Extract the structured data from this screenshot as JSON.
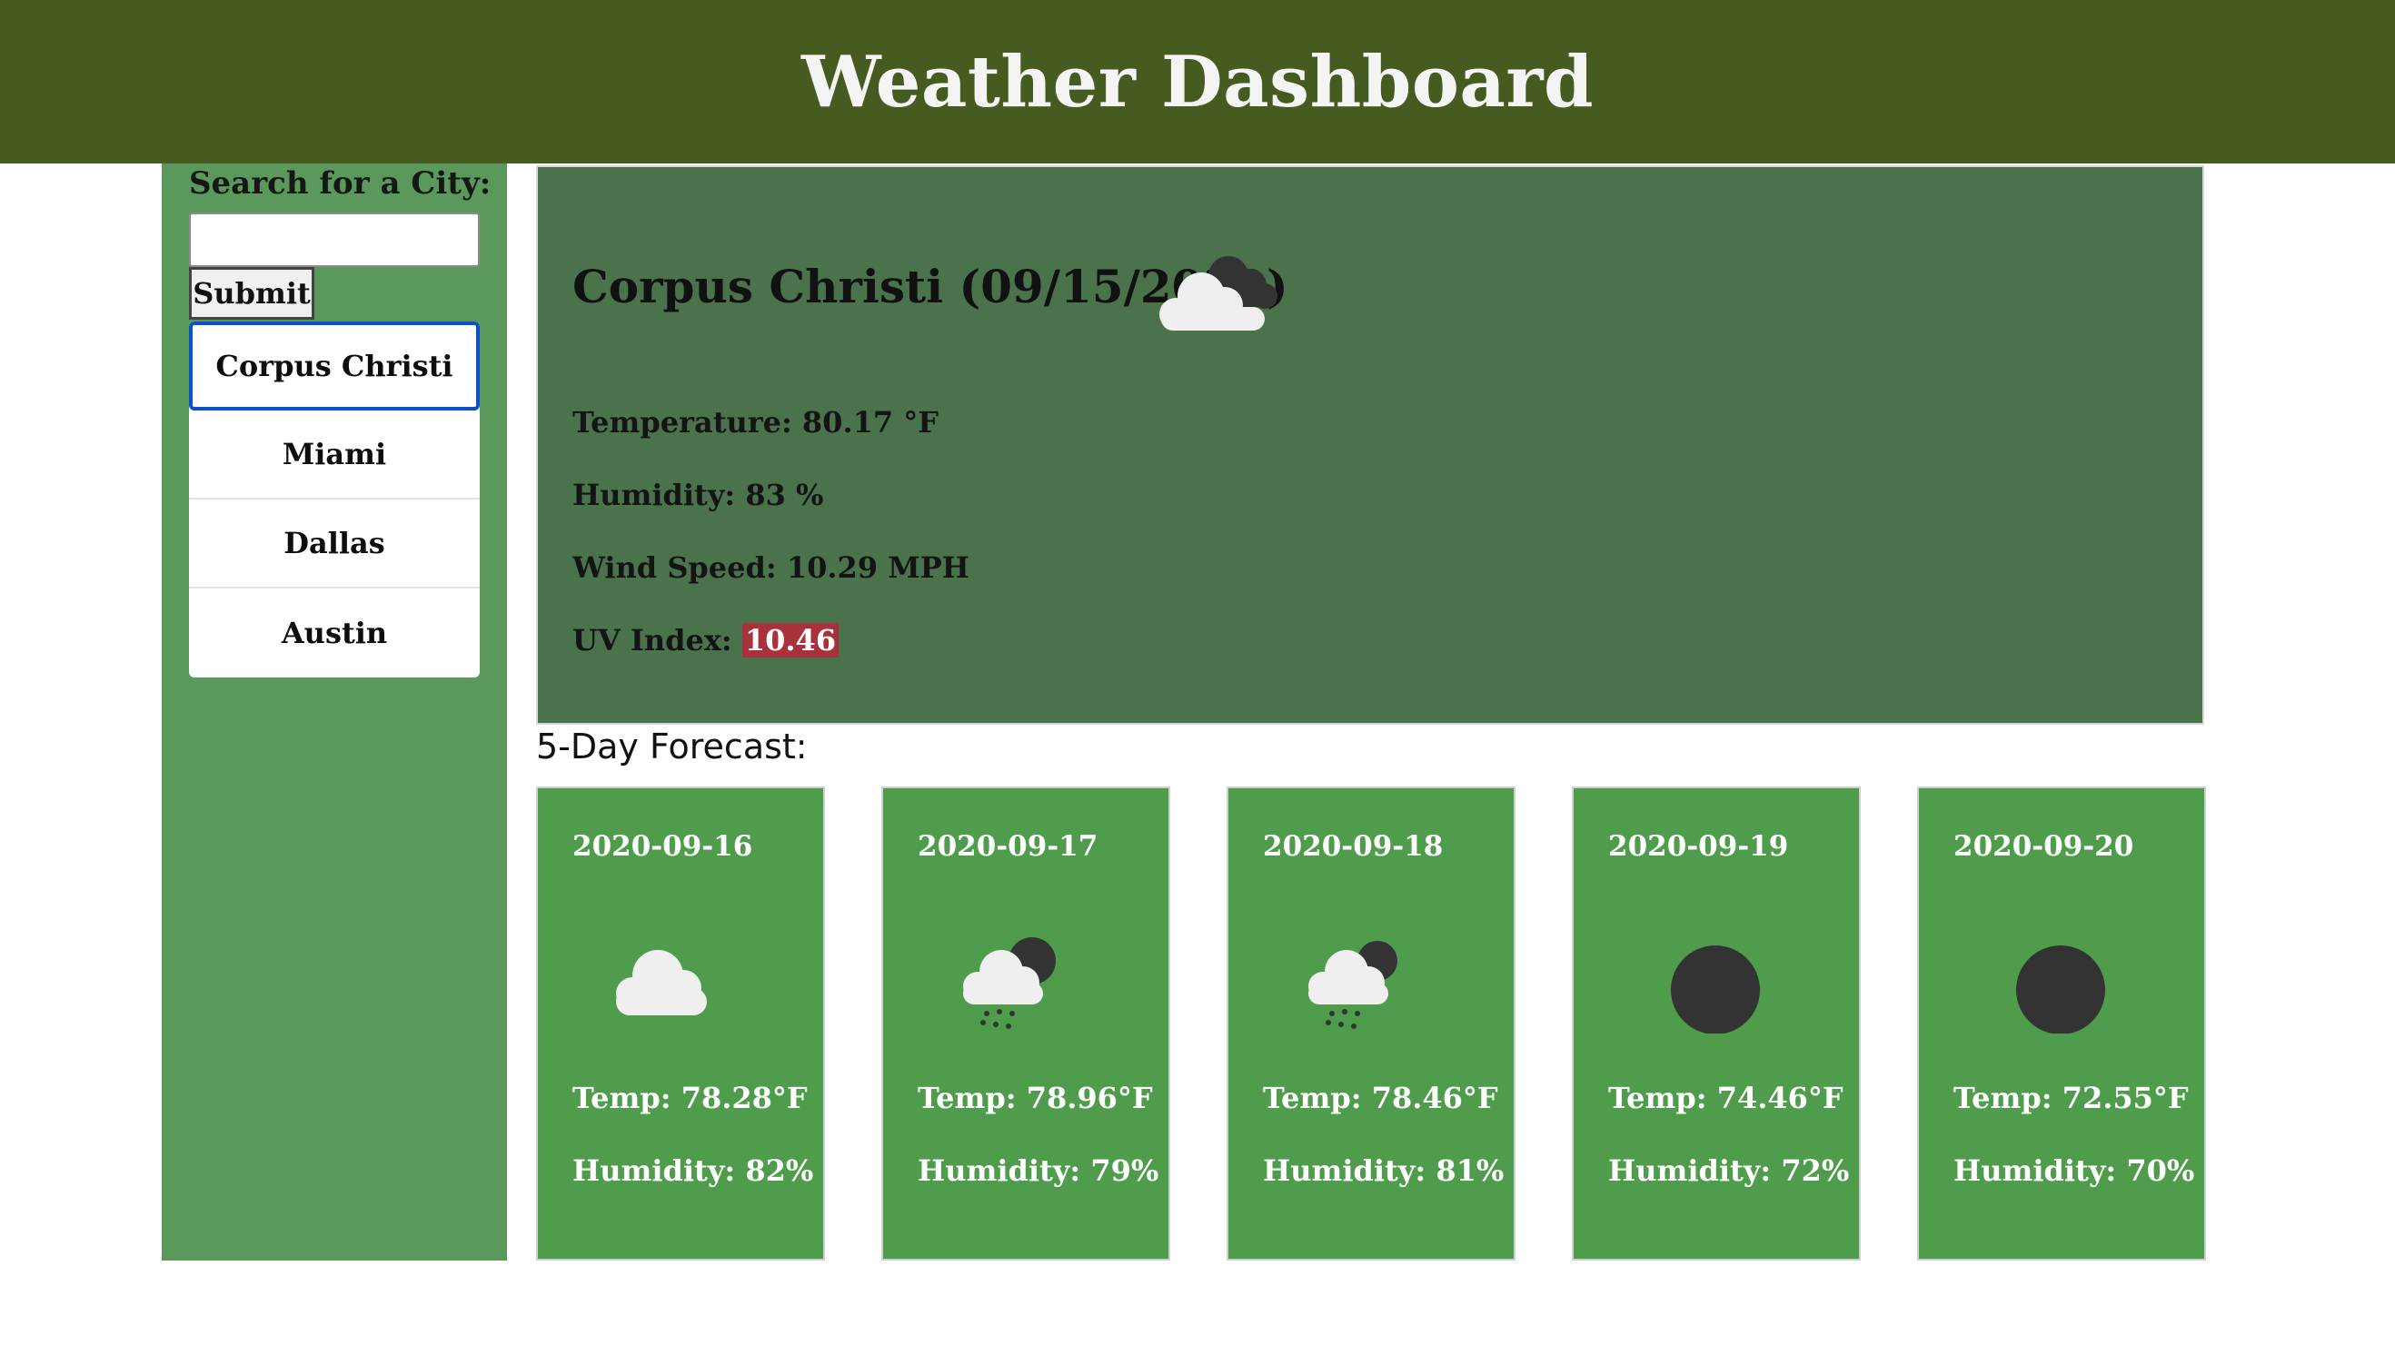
{
  "header": {
    "title": "Weather Dashboard"
  },
  "sidebar": {
    "search_label": "Search for a City:",
    "search_value": "",
    "submit_label": "Submit",
    "cities": [
      {
        "label": "Corpus Christi",
        "active": true
      },
      {
        "label": "Miami",
        "active": false
      },
      {
        "label": "Dallas",
        "active": false
      },
      {
        "label": "Austin",
        "active": false
      }
    ]
  },
  "current": {
    "title": "Corpus Christi (09/15/2020)",
    "icon": "broken-clouds-icon",
    "temperature": "Temperature: 80.17 °F",
    "humidity": "Humidity: 83 %",
    "wind": "Wind Speed: 10.29 MPH",
    "uv_label": "UV Index: ",
    "uv_value": "10.46",
    "uv_color": "#a8323b"
  },
  "forecast": {
    "heading": "5-Day Forecast:",
    "days": [
      {
        "date": "2020-09-16",
        "icon": "cloud-icon",
        "temp": "Temp: 78.28°F",
        "humidity": "Humidity: 82%"
      },
      {
        "date": "2020-09-17",
        "icon": "rain-cloud-icon",
        "temp": "Temp: 78.96°F",
        "humidity": "Humidity: 79%"
      },
      {
        "date": "2020-09-18",
        "icon": "rain-cloud-icon",
        "temp": "Temp: 78.46°F",
        "humidity": "Humidity: 81%"
      },
      {
        "date": "2020-09-19",
        "icon": "clear-night-icon",
        "temp": "Temp: 74.46°F",
        "humidity": "Humidity: 72%"
      },
      {
        "date": "2020-09-20",
        "icon": "clear-night-icon",
        "temp": "Temp: 72.55°F",
        "humidity": "Humidity: 70%"
      }
    ]
  },
  "colors": {
    "header_bg": "#465b1f",
    "sidebar_bg": "#5b985c",
    "current_bg": "#4a734c",
    "card_bg": "#4f9d4c",
    "active_border": "#0a51c9"
  }
}
